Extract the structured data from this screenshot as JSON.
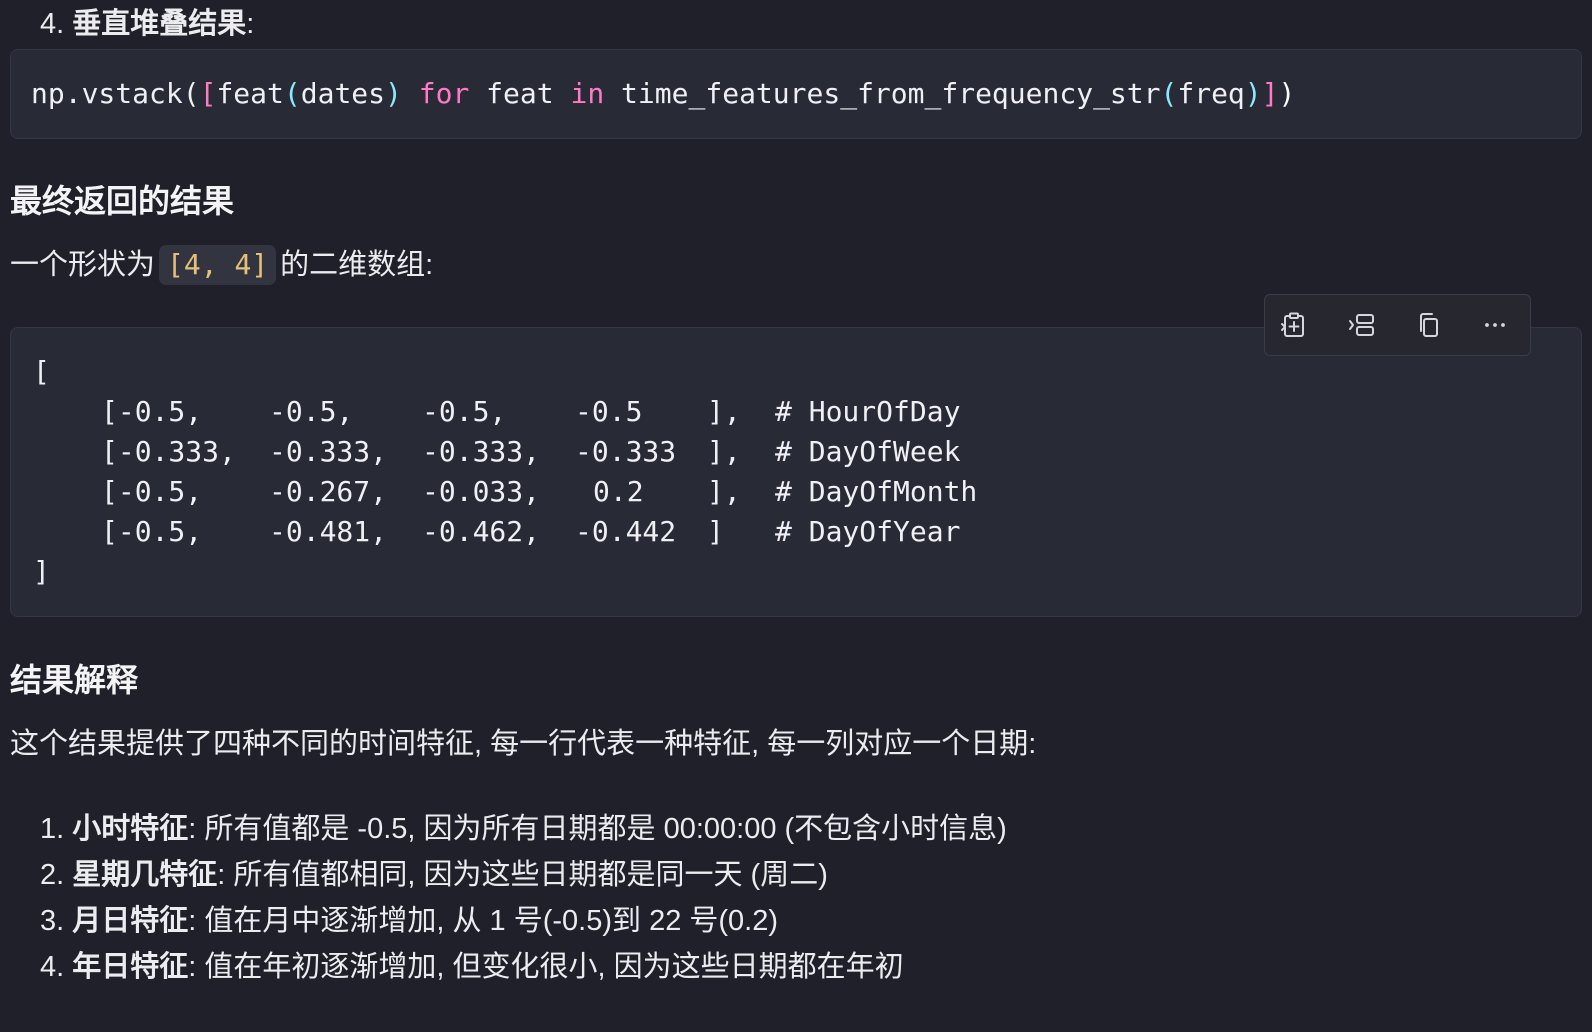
{
  "step4": {
    "num": "4.",
    "title": "垂直堆叠结果",
    "colon": ":"
  },
  "code1": {
    "tokens": {
      "a": "np.vstack(",
      "b": "[",
      "c": "feat",
      "d": "(",
      "e": "dates",
      "f": ")",
      "g": " ",
      "h": "for",
      "i": " feat ",
      "j": "in",
      "k": " time_features_from_frequency_str",
      "l": "(",
      "m": "freq",
      "n": ")",
      "o": "]",
      "p": ")"
    }
  },
  "section_result": {
    "title": "最终返回的结果",
    "desc_pre": "一个形状为",
    "shape": "[4, 4]",
    "desc_post": "的二维数组:"
  },
  "code2": {
    "open": "[",
    "close": "]",
    "rows": [
      {
        "open": "[-0.5,",
        "c2": "-0.5,",
        "c3": "-0.5,",
        "c4": "-0.5",
        "end": "],",
        "comment": "# HourOfDay"
      },
      {
        "open": "[-0.333,",
        "c2": "-0.333,",
        "c3": "-0.333,",
        "c4": "-0.333",
        "end": "],",
        "comment": "# DayOfWeek"
      },
      {
        "open": "[-0.5,",
        "c2": "-0.267,",
        "c3": "-0.033,",
        "c4": "0.2",
        "end": "],",
        "comment": "# DayOfMonth"
      },
      {
        "open": "[-0.5,",
        "c2": "-0.481,",
        "c3": "-0.462,",
        "c4": "-0.442",
        "end": "]",
        "comment": "# DayOfYear"
      }
    ]
  },
  "toolbar": {
    "icons": [
      "insert-at-cursor-icon",
      "insert-new-block-icon",
      "copy-icon",
      "more-icon"
    ]
  },
  "section_explain": {
    "title": "结果解释",
    "intro": "这个结果提供了四种不同的时间特征, 每一行代表一种特征, 每一列对应一个日期:"
  },
  "list": [
    {
      "num": "1.",
      "label": "小时特征",
      "text": ": 所有值都是 -0.5, 因为所有日期都是 00:00:00 (不包含小时信息)"
    },
    {
      "num": "2.",
      "label": "星期几特征",
      "text": ": 所有值都相同, 因为这些日期都是同一天 (周二)"
    },
    {
      "num": "3.",
      "label": "月日特征",
      "text": ": 值在月中逐渐增加, 从 1 号(-0.5)到 22 号(0.2)"
    },
    {
      "num": "4.",
      "label": "年日特征",
      "text": ": 值在年初逐渐增加, 但变化很小, 因为这些日期都在年初"
    }
  ]
}
